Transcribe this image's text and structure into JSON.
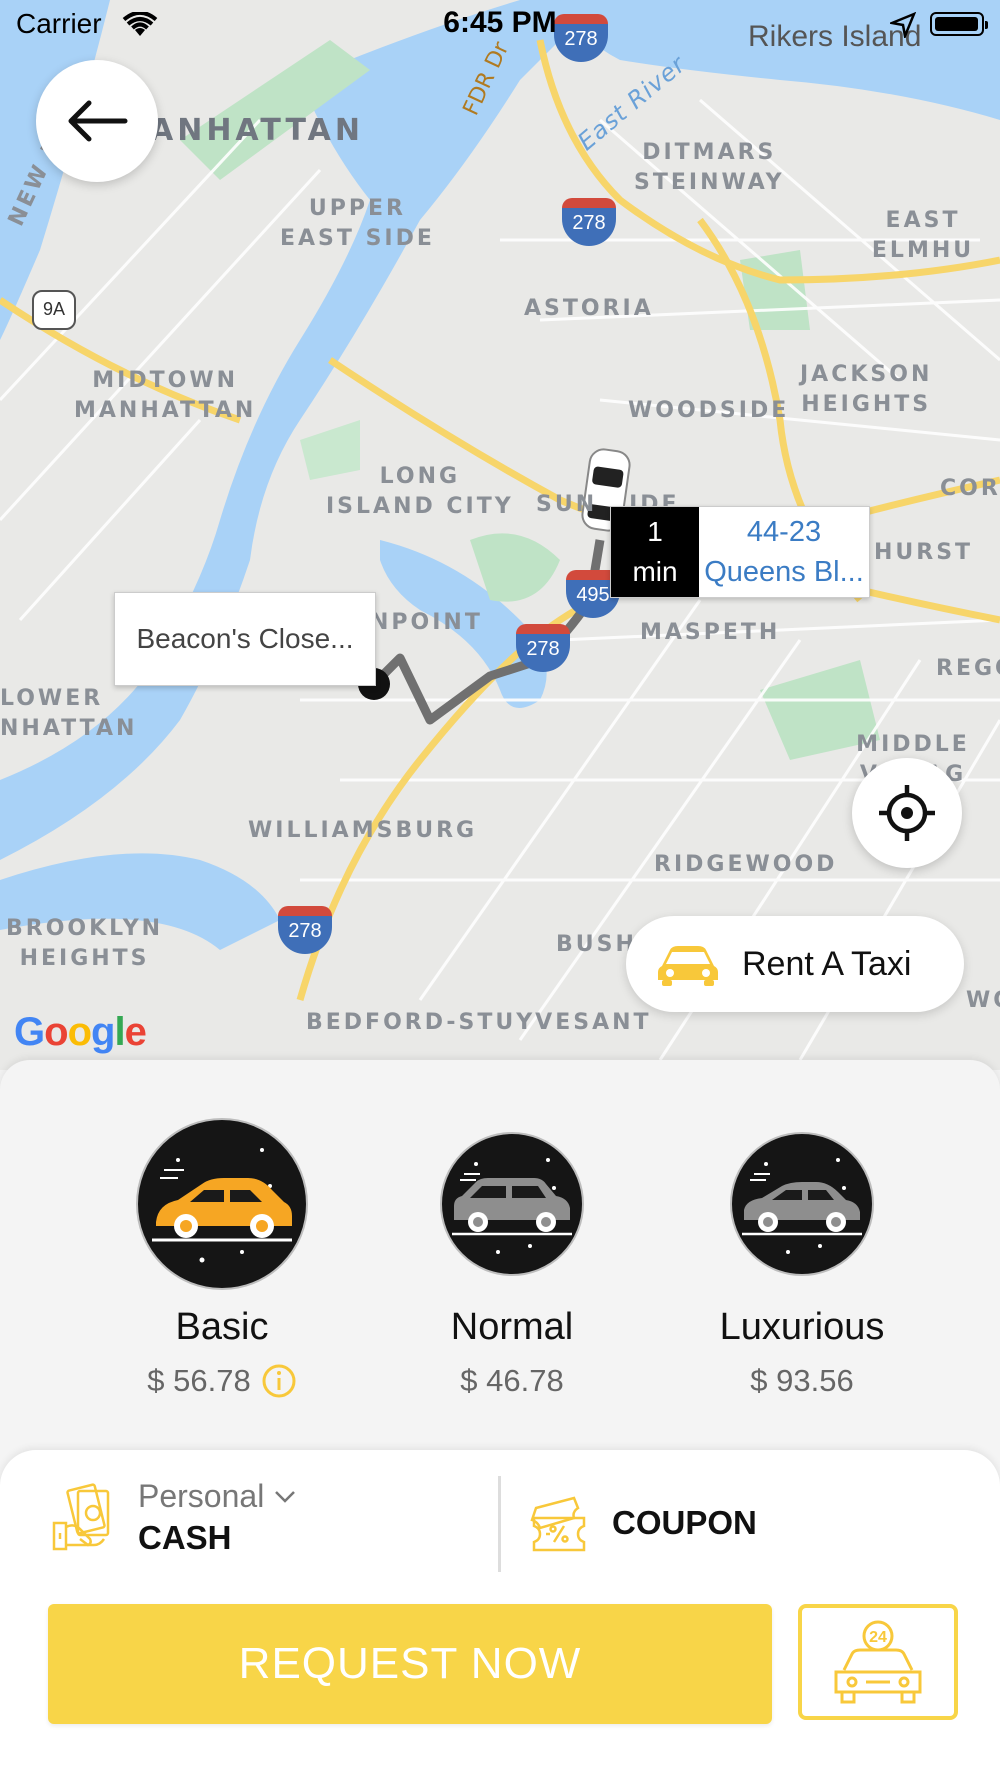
{
  "status_bar": {
    "carrier": "Carrier",
    "time": "6:45 PM"
  },
  "map": {
    "labels": {
      "manhattan": "ANHATTAN",
      "rikers": "Rikers Island",
      "ditmars": "DITMARS\nSTEINWAY",
      "upper_east": "UPPER\nEAST SIDE",
      "east_elmhurst": "EAST ELMHU",
      "astoria": "ASTORIA",
      "midtown": "MIDTOWN\nMANHATTAN",
      "jackson": "JACKSON\nHEIGHTS",
      "woodside": "WOODSIDE",
      "long_island": "LONG\nISLAND CITY",
      "sunnyside": "SUN   IDE",
      "corona": "CORO",
      "hurst": "HURST",
      "greenpoint": "NPOINT",
      "maspeth": "MASPETH",
      "rego": "REGO",
      "lower_manhattan": "LOWER\nNHATTAN",
      "middle_village": "MIDDLE VILLAG",
      "williamsburg": "WILLIAMSBURG",
      "ridgewood": "RIDGEWOOD",
      "brooklyn_heights": "BROOKLYN\nHEIGHTS",
      "bushwick": "BUSHW",
      "wo": "WO",
      "bedford": "BEDFORD-STUYVESANT",
      "new_jersey": "NEW J",
      "east_river": "East River",
      "fdr": "FDR Dr"
    },
    "shields": {
      "i278_a": "278",
      "i278_b": "278",
      "i278_c": "278",
      "i278_d": "278",
      "i495": "495",
      "ny9a": "9A"
    },
    "pickup_callout": "Beacon's Close...",
    "eta": {
      "value": "1",
      "unit": "min",
      "address_line1": "44-23",
      "address_line2": "Queens Bl..."
    },
    "rent_button": "Rent A Taxi",
    "google_logo": "Google"
  },
  "vehicles": [
    {
      "name": "Basic",
      "price": "$ 56.78",
      "selected": true
    },
    {
      "name": "Normal",
      "price": "$ 46.78",
      "selected": false
    },
    {
      "name": "Luxurious",
      "price": "$ 93.56",
      "selected": false
    }
  ],
  "payment": {
    "mode": "Personal",
    "method": "CASH"
  },
  "coupon": {
    "label": "COUPON"
  },
  "request_button": "REQUEST NOW",
  "colors": {
    "accent": "#f8d548",
    "car_basic": "#f6a623",
    "car_other": "#8e8e8e",
    "eta_text": "#3b7cc4"
  }
}
